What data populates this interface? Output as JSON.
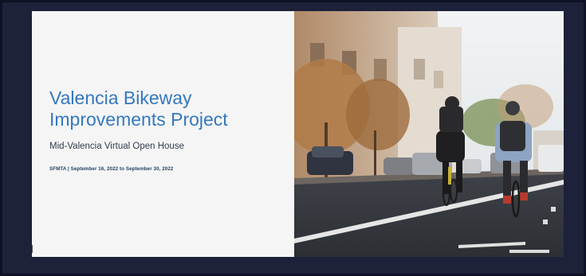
{
  "slide": {
    "title_line1": "Valencia Bikeway",
    "title_line2": "Improvements Project",
    "subtitle": "Mid-Valencia Virtual Open House",
    "meta": "SFMTA | September 16, 2022 to September 30, 2022"
  },
  "colors": {
    "background": "#1d2139",
    "title": "#3478c0",
    "slide": "#f5f5f5"
  },
  "photo": {
    "icon": "street-cyclists-photo"
  }
}
